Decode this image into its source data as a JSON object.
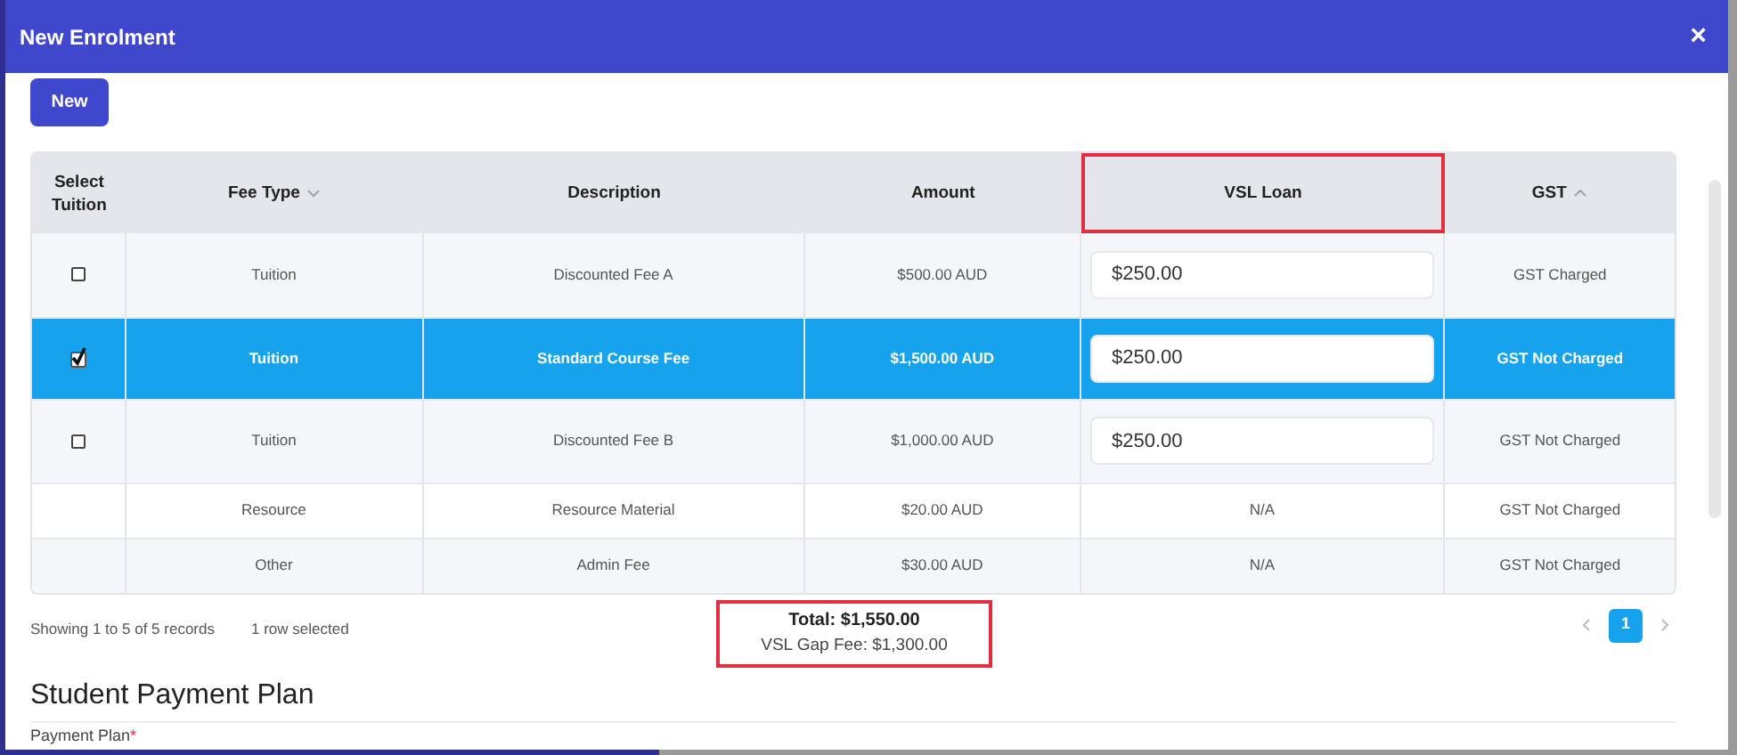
{
  "dialog": {
    "title": "New Enrolment",
    "close": "×"
  },
  "new_button": "New",
  "table": {
    "columns": [
      {
        "label": "Select Tuition",
        "kind": "plain",
        "highlighted": false
      },
      {
        "label": "Fee Type",
        "kind": "descending",
        "highlighted": false
      },
      {
        "label": "Description",
        "kind": "plain",
        "highlighted": false
      },
      {
        "label": "Amount",
        "kind": "plain",
        "highlighted": false
      },
      {
        "label": "VSL Loan",
        "kind": "plain",
        "highlighted": true
      },
      {
        "label": "GST",
        "kind": "ascending",
        "highlighted": false
      }
    ],
    "rows": [
      {
        "kind": "tuition",
        "checked": false,
        "selected": false,
        "fee_type": "Tuition",
        "description": "Discounted Fee A",
        "amount": "$500.00 AUD",
        "vsl": "$250.00",
        "gst": "GST Charged"
      },
      {
        "kind": "tuition",
        "checked": true,
        "selected": true,
        "fee_type": "Tuition",
        "description": "Standard Course Fee",
        "amount": "$1,500.00 AUD",
        "vsl": "$250.00",
        "gst": "GST Not Charged"
      },
      {
        "kind": "tuition",
        "checked": false,
        "selected": false,
        "fee_type": "Tuition",
        "description": "Discounted Fee B",
        "amount": "$1,000.00 AUD",
        "vsl": "$250.00",
        "gst": "GST Not Charged"
      },
      {
        "kind": "fixed",
        "selected": false,
        "fee_type": "Resource",
        "description": "Resource Material",
        "amount": "$20.00 AUD",
        "vsl": "N/A",
        "gst": "GST Not Charged"
      },
      {
        "kind": "fixed",
        "selected": false,
        "fee_type": "Other",
        "description": "Admin Fee",
        "amount": "$30.00 AUD",
        "vsl": "N/A",
        "gst": "GST Not Charged"
      }
    ]
  },
  "footer": {
    "records": "Showing 1 to 5 of 5 records",
    "selection": "1 row selected",
    "total": "Total: $1,550.00",
    "gap_fee": "VSL Gap Fee: $1,300.00",
    "highlighted": true,
    "pages": [
      {
        "label": "1",
        "selected": true
      }
    ]
  },
  "section": {
    "title": "Student Payment Plan",
    "field_label": "Payment Plan",
    "required": "*"
  }
}
